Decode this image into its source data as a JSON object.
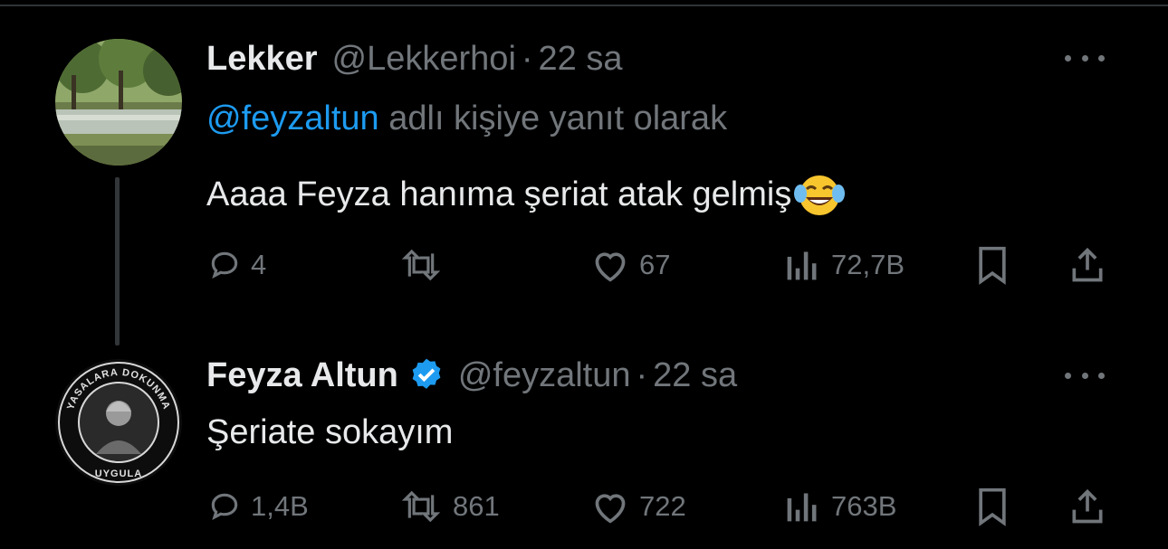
{
  "tweets": [
    {
      "name": "Lekker",
      "handle": "@Lekkerhoi",
      "separator": "·",
      "time": "22 sa",
      "reply_mention": "@feyzaltun",
      "reply_suffix": " adlı kişiye yanıt olarak",
      "text": "Aaaa Feyza hanıma şeriat atak gelmiş",
      "emoji": "face-with-tears-of-joy",
      "avatar_icon": "park-canal-photo",
      "replies": "4",
      "retweets": "",
      "likes": "67",
      "views": "72,7B"
    },
    {
      "name": "Feyza Altun",
      "verified": true,
      "handle": "@feyzaltun",
      "separator": "·",
      "time": "22 sa",
      "text": "Şeriate sokayım",
      "avatar_icon": "profile-badge-photo",
      "avatar_ring_top": "YASALARA DOKUNMA",
      "avatar_ring_bottom": "UYGULA",
      "replies": "1,4B",
      "retweets": "861",
      "likes": "722",
      "views": "763B"
    }
  ],
  "colors": {
    "background": "#000000",
    "text": "#e7e9ea",
    "muted": "#71767b",
    "link": "#1d9bf0",
    "verified": "#1d9bf0"
  }
}
